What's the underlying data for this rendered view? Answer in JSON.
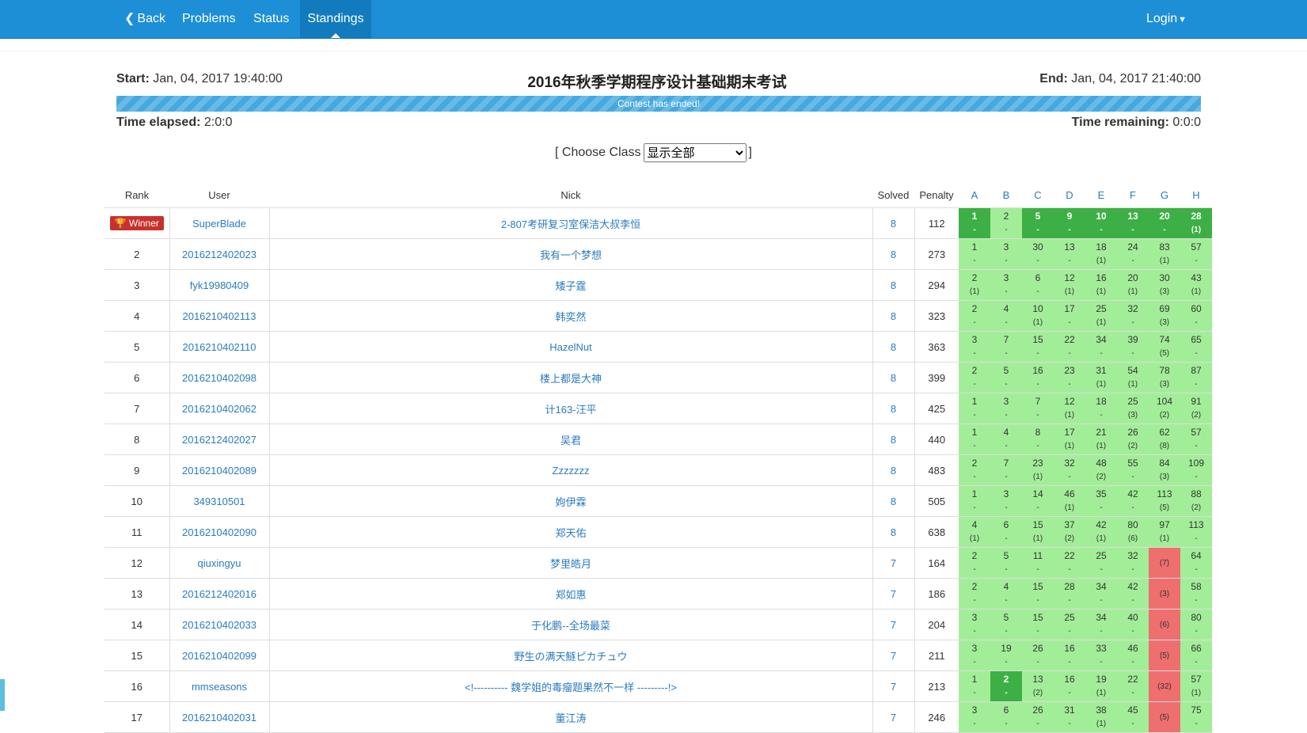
{
  "nav": {
    "back": "Back",
    "problems": "Problems",
    "status": "Status",
    "standings": "Standings",
    "login": "Login"
  },
  "contest": {
    "start_label": "Start:",
    "start_value": "Jan, 04, 2017 19:40:00",
    "title": "2016年秋季学期程序设计基础期末考试",
    "end_label": "End:",
    "end_value": "Jan, 04, 2017 21:40:00",
    "progress_text": "Contest has ended!",
    "progress_fraction": 1.0,
    "elapsed_label": "Time elapsed:",
    "elapsed_value": "2:0:0",
    "remaining_label": "Time remaining:",
    "remaining_value": "0:0:0"
  },
  "filter": {
    "open": "[",
    "label": "Choose Class",
    "selected": "显示全部",
    "close": "]"
  },
  "columns": {
    "rank": "Rank",
    "user": "User",
    "nick": "Nick",
    "solved": "Solved",
    "penalty": "Penalty",
    "problems": [
      "A",
      "B",
      "C",
      "D",
      "E",
      "F",
      "G",
      "H"
    ]
  },
  "winner_label": "Winner",
  "colors": {
    "navbar": "#1c8fd6",
    "accepted": "#a2ee98",
    "first_blood": "#3cb044",
    "wrong": "#ef6f6f",
    "winner": "#c9302c",
    "link": "#2a7bbf"
  },
  "rows": [
    {
      "rank": "Winner",
      "user": "SuperBlade",
      "nick": "2-807考研复习室保洁大叔李恒",
      "solved": "8",
      "penalty": "112",
      "cells": [
        [
          "1",
          "-",
          "fb"
        ],
        [
          "2",
          "-",
          "ac"
        ],
        [
          "5",
          "-",
          "fb"
        ],
        [
          "9",
          "-",
          "fb"
        ],
        [
          "10",
          "-",
          "fb"
        ],
        [
          "13",
          "-",
          "fb"
        ],
        [
          "20",
          "-",
          "fb"
        ],
        [
          "28",
          "(1)",
          "fb"
        ]
      ]
    },
    {
      "rank": "2",
      "user": "2016212402023",
      "nick": "我有一个梦想",
      "solved": "8",
      "penalty": "273",
      "cells": [
        [
          "1",
          "-",
          "ac"
        ],
        [
          "3",
          "-",
          "ac"
        ],
        [
          "30",
          "-",
          "ac"
        ],
        [
          "13",
          "-",
          "ac"
        ],
        [
          "18",
          "(1)",
          "ac"
        ],
        [
          "24",
          "-",
          "ac"
        ],
        [
          "83",
          "(1)",
          "ac"
        ],
        [
          "57",
          "-",
          "ac"
        ]
      ]
    },
    {
      "rank": "3",
      "user": "fyk19980409",
      "nick": "矮子霆",
      "solved": "8",
      "penalty": "294",
      "cells": [
        [
          "2",
          "(1)",
          "ac"
        ],
        [
          "3",
          "-",
          "ac"
        ],
        [
          "6",
          "-",
          "ac"
        ],
        [
          "12",
          "(1)",
          "ac"
        ],
        [
          "16",
          "(1)",
          "ac"
        ],
        [
          "20",
          "(1)",
          "ac"
        ],
        [
          "30",
          "(3)",
          "ac"
        ],
        [
          "43",
          "(1)",
          "ac"
        ]
      ]
    },
    {
      "rank": "4",
      "user": "2016210402113",
      "nick": "韩奕然",
      "solved": "8",
      "penalty": "323",
      "cells": [
        [
          "2",
          "-",
          "ac"
        ],
        [
          "4",
          "-",
          "ac"
        ],
        [
          "10",
          "(1)",
          "ac"
        ],
        [
          "17",
          "-",
          "ac"
        ],
        [
          "25",
          "(1)",
          "ac"
        ],
        [
          "32",
          "-",
          "ac"
        ],
        [
          "69",
          "(3)",
          "ac"
        ],
        [
          "60",
          "-",
          "ac"
        ]
      ]
    },
    {
      "rank": "5",
      "user": "2016210402110",
      "nick": "HazelNut",
      "solved": "8",
      "penalty": "363",
      "cells": [
        [
          "3",
          "-",
          "ac"
        ],
        [
          "7",
          "-",
          "ac"
        ],
        [
          "15",
          "-",
          "ac"
        ],
        [
          "22",
          "-",
          "ac"
        ],
        [
          "34",
          "-",
          "ac"
        ],
        [
          "39",
          "-",
          "ac"
        ],
        [
          "74",
          "(5)",
          "ac"
        ],
        [
          "65",
          "-",
          "ac"
        ]
      ]
    },
    {
      "rank": "6",
      "user": "2016210402098",
      "nick": "楼上都是大神",
      "solved": "8",
      "penalty": "399",
      "cells": [
        [
          "2",
          "-",
          "ac"
        ],
        [
          "5",
          "-",
          "ac"
        ],
        [
          "16",
          "-",
          "ac"
        ],
        [
          "23",
          "-",
          "ac"
        ],
        [
          "31",
          "(1)",
          "ac"
        ],
        [
          "54",
          "(1)",
          "ac"
        ],
        [
          "78",
          "(3)",
          "ac"
        ],
        [
          "87",
          "-",
          "ac"
        ]
      ]
    },
    {
      "rank": "7",
      "user": "2016210402062",
      "nick": "计163-汪平",
      "solved": "8",
      "penalty": "425",
      "cells": [
        [
          "1",
          "-",
          "ac"
        ],
        [
          "3",
          "-",
          "ac"
        ],
        [
          "7",
          "-",
          "ac"
        ],
        [
          "12",
          "(1)",
          "ac"
        ],
        [
          "18",
          "-",
          "ac"
        ],
        [
          "25",
          "(3)",
          "ac"
        ],
        [
          "104",
          "(2)",
          "ac"
        ],
        [
          "91",
          "(2)",
          "ac"
        ]
      ]
    },
    {
      "rank": "8",
      "user": "2016212402027",
      "nick": "吴君",
      "solved": "8",
      "penalty": "440",
      "cells": [
        [
          "1",
          "-",
          "ac"
        ],
        [
          "4",
          "-",
          "ac"
        ],
        [
          "8",
          "-",
          "ac"
        ],
        [
          "17",
          "(1)",
          "ac"
        ],
        [
          "21",
          "(1)",
          "ac"
        ],
        [
          "26",
          "(2)",
          "ac"
        ],
        [
          "62",
          "(8)",
          "ac"
        ],
        [
          "57",
          "-",
          "ac"
        ]
      ]
    },
    {
      "rank": "9",
      "user": "2016210402089",
      "nick": "Zzzzzzz",
      "solved": "8",
      "penalty": "483",
      "cells": [
        [
          "2",
          "-",
          "ac"
        ],
        [
          "7",
          "-",
          "ac"
        ],
        [
          "23",
          "(1)",
          "ac"
        ],
        [
          "32",
          "-",
          "ac"
        ],
        [
          "48",
          "(2)",
          "ac"
        ],
        [
          "55",
          "-",
          "ac"
        ],
        [
          "84",
          "(3)",
          "ac"
        ],
        [
          "109",
          "-",
          "ac"
        ]
      ]
    },
    {
      "rank": "10",
      "user": "349310501",
      "nick": "姁伊霖",
      "solved": "8",
      "penalty": "505",
      "cells": [
        [
          "1",
          "-",
          "ac"
        ],
        [
          "3",
          "-",
          "ac"
        ],
        [
          "14",
          "-",
          "ac"
        ],
        [
          "46",
          "(1)",
          "ac"
        ],
        [
          "35",
          "-",
          "ac"
        ],
        [
          "42",
          "-",
          "ac"
        ],
        [
          "113",
          "(5)",
          "ac"
        ],
        [
          "88",
          "(2)",
          "ac"
        ]
      ]
    },
    {
      "rank": "11",
      "user": "2016210402090",
      "nick": "郑天佑",
      "solved": "8",
      "penalty": "638",
      "cells": [
        [
          "4",
          "(1)",
          "ac"
        ],
        [
          "6",
          "-",
          "ac"
        ],
        [
          "15",
          "(1)",
          "ac"
        ],
        [
          "37",
          "(2)",
          "ac"
        ],
        [
          "42",
          "(1)",
          "ac"
        ],
        [
          "80",
          "(6)",
          "ac"
        ],
        [
          "97",
          "(1)",
          "ac"
        ],
        [
          "113",
          "-",
          "ac"
        ]
      ]
    },
    {
      "rank": "12",
      "user": "qiuxingyu",
      "nick": "梦里皓月",
      "solved": "7",
      "penalty": "164",
      "cells": [
        [
          "2",
          "-",
          "ac"
        ],
        [
          "5",
          "-",
          "ac"
        ],
        [
          "11",
          "-",
          "ac"
        ],
        [
          "22",
          "-",
          "ac"
        ],
        [
          "25",
          "-",
          "ac"
        ],
        [
          "32",
          "-",
          "ac"
        ],
        [
          "",
          "(7)",
          "wa"
        ],
        [
          "64",
          "-",
          "ac"
        ]
      ]
    },
    {
      "rank": "13",
      "user": "2016212402016",
      "nick": "郑如惠",
      "solved": "7",
      "penalty": "186",
      "cells": [
        [
          "2",
          "-",
          "ac"
        ],
        [
          "4",
          "-",
          "ac"
        ],
        [
          "15",
          "-",
          "ac"
        ],
        [
          "28",
          "-",
          "ac"
        ],
        [
          "34",
          "-",
          "ac"
        ],
        [
          "42",
          "-",
          "ac"
        ],
        [
          "",
          "(3)",
          "wa"
        ],
        [
          "58",
          "-",
          "ac"
        ]
      ]
    },
    {
      "rank": "14",
      "user": "2016210402033",
      "nick": "于化鹏--全场最菜",
      "solved": "7",
      "penalty": "204",
      "cells": [
        [
          "3",
          "-",
          "ac"
        ],
        [
          "5",
          "-",
          "ac"
        ],
        [
          "15",
          "-",
          "ac"
        ],
        [
          "25",
          "-",
          "ac"
        ],
        [
          "34",
          "-",
          "ac"
        ],
        [
          "40",
          "-",
          "ac"
        ],
        [
          "",
          "(6)",
          "wa"
        ],
        [
          "80",
          "-",
          "ac"
        ]
      ]
    },
    {
      "rank": "15",
      "user": "2016210402099",
      "nick": "野生の满天鱁ピカチュウ",
      "solved": "7",
      "penalty": "211",
      "cells": [
        [
          "3",
          "-",
          "ac"
        ],
        [
          "19",
          "-",
          "ac"
        ],
        [
          "26",
          "-",
          "ac"
        ],
        [
          "16",
          "-",
          "ac"
        ],
        [
          "33",
          "-",
          "ac"
        ],
        [
          "46",
          "-",
          "ac"
        ],
        [
          "",
          "(5)",
          "wa"
        ],
        [
          "66",
          "-",
          "ac"
        ]
      ]
    },
    {
      "rank": "16",
      "user": "mmseasons",
      "nick": "<!---------- 魏学姐的毒瘤题果然不一样 ---------!>",
      "solved": "7",
      "penalty": "213",
      "cells": [
        [
          "1",
          "-",
          "ac"
        ],
        [
          "2",
          "-",
          "fb"
        ],
        [
          "13",
          "(2)",
          "ac"
        ],
        [
          "16",
          "-",
          "ac"
        ],
        [
          "19",
          "(1)",
          "ac"
        ],
        [
          "22",
          "-",
          "ac"
        ],
        [
          "",
          "(32)",
          "wa"
        ],
        [
          "57",
          "(1)",
          "ac"
        ]
      ]
    },
    {
      "rank": "17",
      "user": "2016210402031",
      "nick": "董江涛",
      "solved": "7",
      "penalty": "246",
      "cells": [
        [
          "3",
          "-",
          "ac"
        ],
        [
          "6",
          "-",
          "ac"
        ],
        [
          "26",
          "-",
          "ac"
        ],
        [
          "31",
          "-",
          "ac"
        ],
        [
          "38",
          "(1)",
          "ac"
        ],
        [
          "45",
          "-",
          "ac"
        ],
        [
          "",
          "(5)",
          "wa"
        ],
        [
          "75",
          "-",
          "ac"
        ]
      ]
    }
  ]
}
